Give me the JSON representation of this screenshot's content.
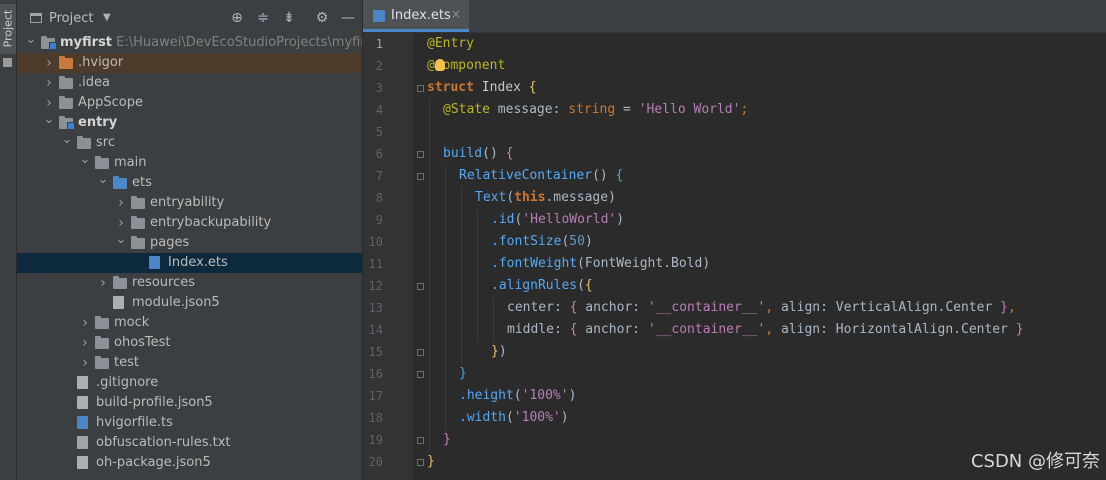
{
  "left_strip": {
    "tab_label": "Project"
  },
  "project_panel": {
    "title": "Project",
    "tools": [
      "crosshair-icon",
      "expand-all-icon",
      "collapse-all-icon",
      "gear-icon",
      "minimize-icon"
    ],
    "tree": [
      {
        "depth": 0,
        "expanded": true,
        "icon": "module-folder",
        "label": "myfirst",
        "path": "E:\\Huawei\\DevEcoStudioProjects\\myfirst",
        "bold": true
      },
      {
        "depth": 1,
        "expanded": false,
        "icon": "folder-orange",
        "label": ".hvigor",
        "highlight": true
      },
      {
        "depth": 1,
        "expanded": false,
        "icon": "folder",
        "label": ".idea"
      },
      {
        "depth": 1,
        "expanded": false,
        "icon": "folder",
        "label": "AppScope"
      },
      {
        "depth": 1,
        "expanded": true,
        "icon": "module-folder",
        "label": "entry",
        "bold": true
      },
      {
        "depth": 2,
        "expanded": true,
        "icon": "folder",
        "label": "src"
      },
      {
        "depth": 3,
        "expanded": true,
        "icon": "folder",
        "label": "main"
      },
      {
        "depth": 4,
        "expanded": true,
        "icon": "folder-blue",
        "label": "ets"
      },
      {
        "depth": 5,
        "expanded": false,
        "icon": "folder",
        "label": "entryability"
      },
      {
        "depth": 5,
        "expanded": false,
        "icon": "folder",
        "label": "entrybackupability"
      },
      {
        "depth": 5,
        "expanded": true,
        "icon": "folder",
        "label": "pages"
      },
      {
        "depth": 6,
        "leaf": true,
        "icon": "file-ets",
        "label": "Index.ets",
        "selected": true
      },
      {
        "depth": 4,
        "expanded": false,
        "icon": "folder",
        "label": "resources"
      },
      {
        "depth": 4,
        "leaf": true,
        "icon": "file",
        "label": "module.json5"
      },
      {
        "depth": 3,
        "expanded": false,
        "icon": "folder",
        "label": "mock"
      },
      {
        "depth": 3,
        "expanded": false,
        "icon": "folder",
        "label": "ohosTest"
      },
      {
        "depth": 3,
        "expanded": false,
        "icon": "folder",
        "label": "test"
      },
      {
        "depth": 2,
        "leaf": true,
        "icon": "file",
        "label": ".gitignore"
      },
      {
        "depth": 2,
        "leaf": true,
        "icon": "file",
        "label": "build-profile.json5"
      },
      {
        "depth": 2,
        "leaf": true,
        "icon": "file-ts",
        "label": "hvigorfile.ts"
      },
      {
        "depth": 2,
        "leaf": true,
        "icon": "file-txt",
        "label": "obfuscation-rules.txt"
      },
      {
        "depth": 2,
        "leaf": true,
        "icon": "file",
        "label": "oh-package.json5"
      }
    ]
  },
  "editor": {
    "tab": {
      "name": "Index.ets",
      "close": "×"
    },
    "current_line": 1,
    "lines": [
      {
        "n": "1",
        "indent": 0,
        "tokens": [
          [
            "@Entry",
            "t-ann"
          ]
        ]
      },
      {
        "n": "2",
        "indent": 0,
        "tokens": [
          [
            "@Component",
            "t-ann"
          ]
        ]
      },
      {
        "n": "3",
        "indent": 0,
        "tokens": [
          [
            "struct ",
            "t-kw"
          ],
          [
            "Index ",
            "t-cls"
          ],
          [
            "{",
            "t-br1"
          ]
        ]
      },
      {
        "n": "4",
        "indent": 1,
        "tokens": [
          [
            "@State ",
            "t-ann"
          ],
          [
            "message",
            "t-plain"
          ],
          [
            ": ",
            "t-plain"
          ],
          [
            "string",
            "t-typ"
          ],
          [
            " = ",
            "t-plain"
          ],
          [
            "'Hello World'",
            "t-strv"
          ],
          [
            ";",
            "t-kw2"
          ]
        ]
      },
      {
        "n": "5",
        "indent": 0,
        "tokens": []
      },
      {
        "n": "6",
        "indent": 1,
        "tokens": [
          [
            "build",
            "t-fn"
          ],
          [
            "() ",
            "t-plain"
          ],
          [
            "{",
            "t-br2"
          ]
        ]
      },
      {
        "n": "7",
        "indent": 2,
        "tokens": [
          [
            "RelativeContainer",
            "t-fn"
          ],
          [
            "() ",
            "t-plain"
          ],
          [
            "{",
            "t-br3"
          ]
        ]
      },
      {
        "n": "8",
        "indent": 3,
        "tokens": [
          [
            "Text",
            "t-fn"
          ],
          [
            "(",
            "t-plain"
          ],
          [
            "this",
            "t-kw"
          ],
          [
            ".message",
            "t-plain"
          ],
          [
            ")",
            "t-plain"
          ]
        ]
      },
      {
        "n": "9",
        "indent": 4,
        "tokens": [
          [
            ".id",
            "t-fn"
          ],
          [
            "(",
            "t-plain"
          ],
          [
            "'HelloWorld'",
            "t-strv"
          ],
          [
            ")",
            "t-plain"
          ]
        ]
      },
      {
        "n": "10",
        "indent": 4,
        "tokens": [
          [
            ".fontSize",
            "t-fn"
          ],
          [
            "(",
            "t-plain"
          ],
          [
            "50",
            "t-num"
          ],
          [
            ")",
            "t-plain"
          ]
        ]
      },
      {
        "n": "11",
        "indent": 4,
        "tokens": [
          [
            ".fontWeight",
            "t-fn"
          ],
          [
            "(",
            "t-plain"
          ],
          [
            "FontWeight",
            "t-plain"
          ],
          [
            ".Bold",
            "t-plain"
          ],
          [
            ")",
            "t-plain"
          ]
        ]
      },
      {
        "n": "12",
        "indent": 4,
        "tokens": [
          [
            ".alignRules",
            "t-fn"
          ],
          [
            "(",
            "t-plain"
          ],
          [
            "{",
            "t-br1"
          ]
        ]
      },
      {
        "n": "13",
        "indent": 5,
        "tokens": [
          [
            "center",
            "t-plain"
          ],
          [
            ": ",
            "t-plain"
          ],
          [
            "{ ",
            "t-br2"
          ],
          [
            "anchor",
            "t-plain"
          ],
          [
            ": ",
            "t-plain"
          ],
          [
            "'__container__'",
            "t-strv"
          ],
          [
            ", ",
            "t-kw2"
          ],
          [
            "align",
            "t-plain"
          ],
          [
            ": ",
            "t-plain"
          ],
          [
            "VerticalAlign",
            "t-plain"
          ],
          [
            ".Center ",
            "t-plain"
          ],
          [
            "}",
            "t-br2"
          ],
          [
            ",",
            "t-kw2"
          ]
        ]
      },
      {
        "n": "14",
        "indent": 5,
        "tokens": [
          [
            "middle",
            "t-plain"
          ],
          [
            ": ",
            "t-plain"
          ],
          [
            "{ ",
            "t-br2"
          ],
          [
            "anchor",
            "t-plain"
          ],
          [
            ": ",
            "t-plain"
          ],
          [
            "'__container__'",
            "t-strv"
          ],
          [
            ", ",
            "t-kw2"
          ],
          [
            "align",
            "t-plain"
          ],
          [
            ": ",
            "t-plain"
          ],
          [
            "HorizontalAlign",
            "t-plain"
          ],
          [
            ".Center ",
            "t-plain"
          ],
          [
            "}",
            "t-br2"
          ]
        ]
      },
      {
        "n": "15",
        "indent": 4,
        "tokens": [
          [
            "}",
            "t-br1"
          ],
          [
            ")",
            "t-plain"
          ]
        ]
      },
      {
        "n": "16",
        "indent": 2,
        "tokens": [
          [
            "}",
            "t-br3"
          ]
        ]
      },
      {
        "n": "17",
        "indent": 2,
        "tokens": [
          [
            ".height",
            "t-fn"
          ],
          [
            "(",
            "t-plain"
          ],
          [
            "'100%'",
            "t-strv"
          ],
          [
            ")",
            "t-plain"
          ]
        ]
      },
      {
        "n": "18",
        "indent": 2,
        "tokens": [
          [
            ".width",
            "t-fn"
          ],
          [
            "(",
            "t-plain"
          ],
          [
            "'100%'",
            "t-strv"
          ],
          [
            ")",
            "t-plain"
          ]
        ]
      },
      {
        "n": "19",
        "indent": 1,
        "tokens": [
          [
            "}",
            "t-br2"
          ]
        ]
      },
      {
        "n": "20",
        "indent": 0,
        "tokens": [
          [
            "}",
            "t-br1"
          ]
        ]
      }
    ],
    "fold_markers": [
      3,
      6,
      7,
      12,
      15,
      16,
      19,
      20
    ]
  },
  "watermark": "CSDN @修可奈"
}
